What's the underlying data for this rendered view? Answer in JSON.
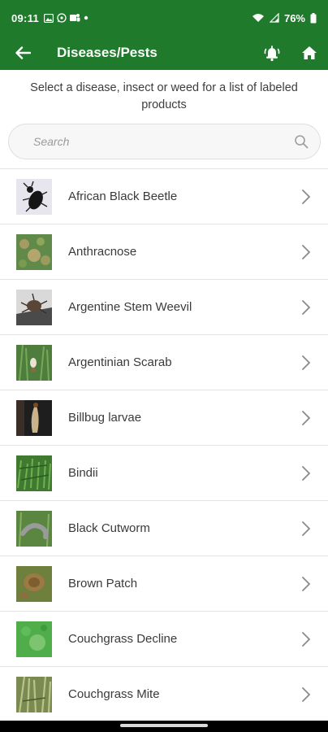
{
  "status_bar": {
    "time": "09:11",
    "battery": "76%",
    "icons": [
      "gallery-icon",
      "whatsapp-icon",
      "teams-icon",
      "dot-icon",
      "wifi-icon",
      "signal-icon",
      "battery-icon"
    ]
  },
  "app_bar": {
    "title": "Diseases/Pests",
    "background_color": "#1f7a2c",
    "icons": [
      "back-arrow-icon",
      "alarm-bell-icon",
      "home-icon"
    ]
  },
  "subtitle": "Select a disease, insect or weed for a list of labeled products",
  "search": {
    "placeholder": "Search",
    "value": ""
  },
  "items": [
    {
      "label": "African Black Beetle"
    },
    {
      "label": "Anthracnose"
    },
    {
      "label": "Argentine Stem Weevil"
    },
    {
      "label": "Argentinian Scarab"
    },
    {
      "label": "Billbug larvae"
    },
    {
      "label": "Bindii"
    },
    {
      "label": "Black Cutworm"
    },
    {
      "label": "Brown Patch"
    },
    {
      "label": "Couchgrass Decline"
    },
    {
      "label": "Couchgrass Mite"
    }
  ]
}
